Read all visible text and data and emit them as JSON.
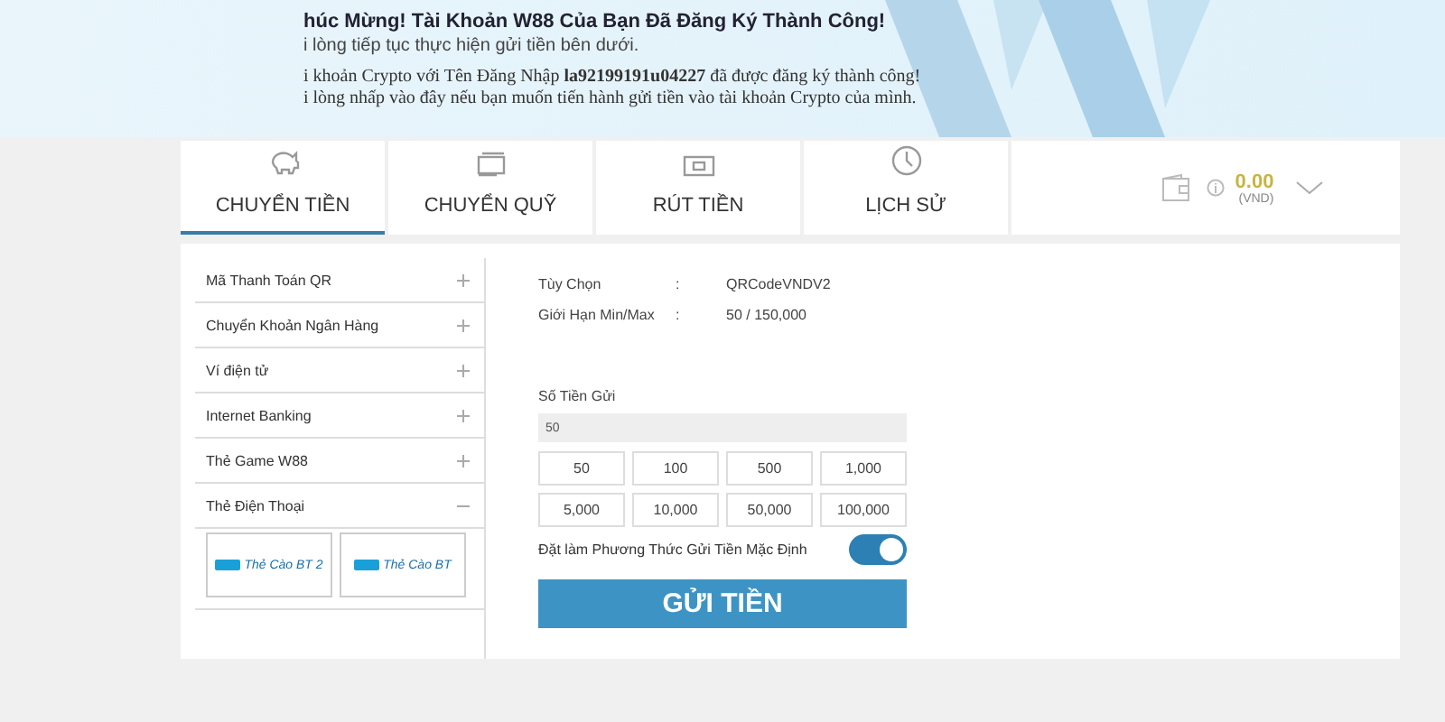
{
  "banner": {
    "title": "húc Mừng! Tài Khoản W88 Của Bạn Đã Đăng Ký Thành Công!",
    "subtitle": "i lòng tiếp tục thực hiện gửi tiền bên dưới.",
    "message": "i khoản Crypto với Tên Đăng Nhập **la92199191u04227** đã được đăng ký thành công!",
    "link": "i lòng nhấp vào đây nếu bạn muốn tiến hành gửi tiền vào tài khoản Crypto của mình."
  },
  "tabs": [
    {
      "label": "CHUYỂN TIỀN",
      "selected": true
    },
    {
      "label": "CHUYỂN QUỸ",
      "selected": false
    },
    {
      "label": "RÚT TIỀN",
      "selected": false
    },
    {
      "label": "LỊCH SỬ",
      "selected": false
    }
  ],
  "balance": {
    "amount": "0.00",
    "currency": "(VND)"
  },
  "methods": [
    {
      "label": "Mã Thanh Toán QR",
      "expanded": false
    },
    {
      "label": "Chuyển Khoản Ngân Hàng",
      "expanded": false
    },
    {
      "label": "Ví điện tử",
      "expanded": false
    },
    {
      "label": "Internet Banking",
      "expanded": false
    },
    {
      "label": "Thẻ Game W88",
      "expanded": false
    },
    {
      "label": "Thẻ Điện Thoại",
      "expanded": true,
      "children": [
        {
          "label": "Thẻ Cào BT 2"
        },
        {
          "label": "Thẻ Cào BT"
        }
      ]
    }
  ],
  "info": [
    {
      "label": "Tùy Chọn",
      "separator": ":",
      "value": "QRCodeVNDV2"
    },
    {
      "label": "Giới Hạn Min/Max",
      "separator": ":",
      "value": "50 / 150,000"
    }
  ],
  "amount_field": {
    "label": "Số Tiền Gửi",
    "value": "50"
  },
  "amount_options": [
    "50",
    "100",
    "500",
    "1,000",
    "5,000",
    "10,000",
    "50,000",
    "100,000"
  ],
  "default_toggle": {
    "label": "Đặt làm Phương Thức Gửi Tiền Mặc Định",
    "on": true
  },
  "submit_button": "GỬI TIỀN"
}
